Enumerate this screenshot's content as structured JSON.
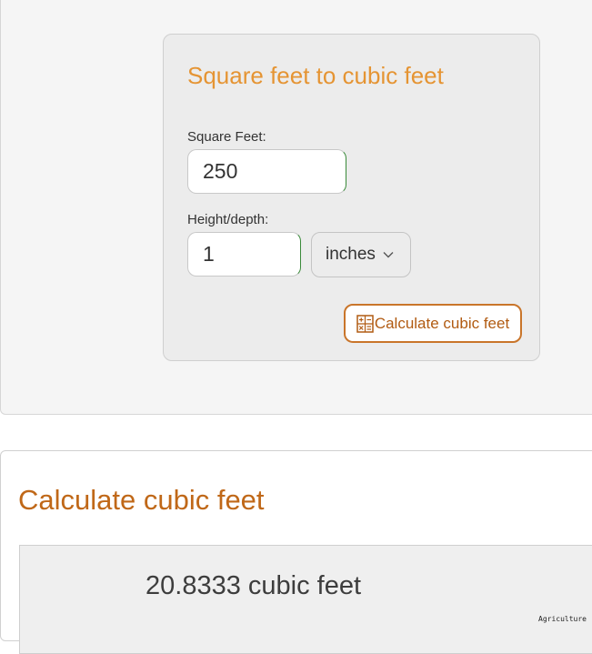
{
  "calculator": {
    "title": "Square feet to cubic feet",
    "square_feet_label": "Square Feet:",
    "square_feet_value": "250",
    "height_label": "Height/depth:",
    "height_value": "1",
    "unit_selected": "inches",
    "calculate_button_label": "Calculate cubic feet"
  },
  "result": {
    "title": "Calculate cubic feet",
    "value_text": "20.8333 cubic feet"
  },
  "watermark": "Agriculture",
  "colors": {
    "title_orange": "#e59433",
    "button_border": "#c9752a",
    "result_title": "#c06818"
  },
  "icons": {
    "calculator": "calculator-icon",
    "dropdown": "chevron-down-icon"
  }
}
